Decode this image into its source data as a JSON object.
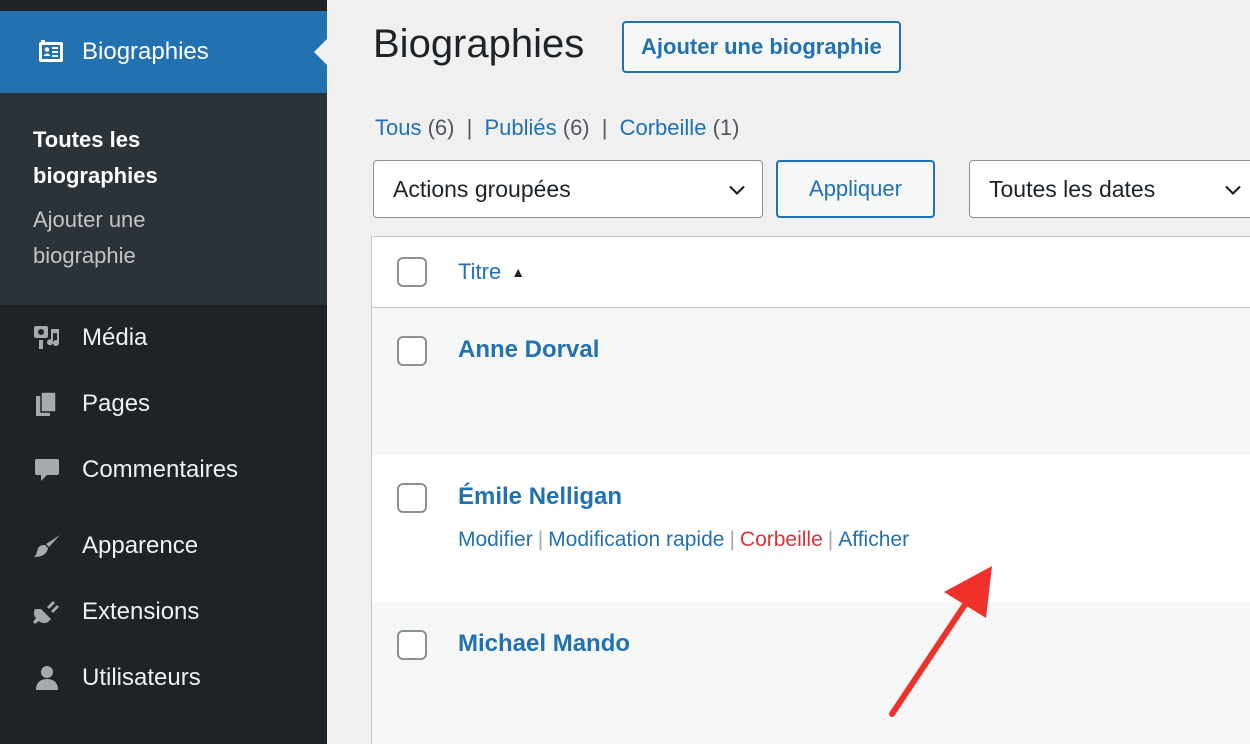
{
  "sidebar": {
    "current_menu": {
      "label": "Biographies",
      "icon": "id-card-icon"
    },
    "submenu": [
      {
        "label": "Toutes les biographies",
        "line1": "Toutes les",
        "line2": "biographies"
      },
      {
        "label": "Ajouter une biographie",
        "line1": "Ajouter une",
        "line2": "biographie"
      }
    ],
    "items": [
      {
        "label": "Média",
        "icon": "media-icon"
      },
      {
        "label": "Pages",
        "icon": "pages-icon"
      },
      {
        "label": "Commentaires",
        "icon": "comment-icon"
      },
      {
        "label": "Apparence",
        "icon": "brush-icon"
      },
      {
        "label": "Extensions",
        "icon": "plugin-icon"
      },
      {
        "label": "Utilisateurs",
        "icon": "user-icon"
      }
    ]
  },
  "header": {
    "title": "Biographies",
    "add_new_label": "Ajouter une biographie"
  },
  "filters": {
    "all": {
      "label": "Tous",
      "count": "(6)"
    },
    "published": {
      "label": "Publiés",
      "count": "(6)"
    },
    "trash": {
      "label": "Corbeille",
      "count": "(1)"
    },
    "separator": "|"
  },
  "toolbar": {
    "bulk_actions": "Actions groupées",
    "apply_label": "Appliquer",
    "date_filter": "Toutes les dates"
  },
  "table": {
    "column_title": "Titre",
    "sort_indicator": "▲",
    "rows": [
      {
        "title": "Anne Dorval"
      },
      {
        "title": "Émile Nelligan",
        "actions": {
          "edit": "Modifier",
          "quick_edit": "Modification rapide",
          "trash": "Corbeille",
          "view": "Afficher",
          "separator": "|"
        }
      },
      {
        "title": "Michael Mando"
      }
    ]
  },
  "colors": {
    "sidebar_bg": "#1d2327",
    "submenu_bg": "#2c3338",
    "accent": "#2271b1",
    "trash": "#d63638",
    "annotation": "#f0302a"
  }
}
